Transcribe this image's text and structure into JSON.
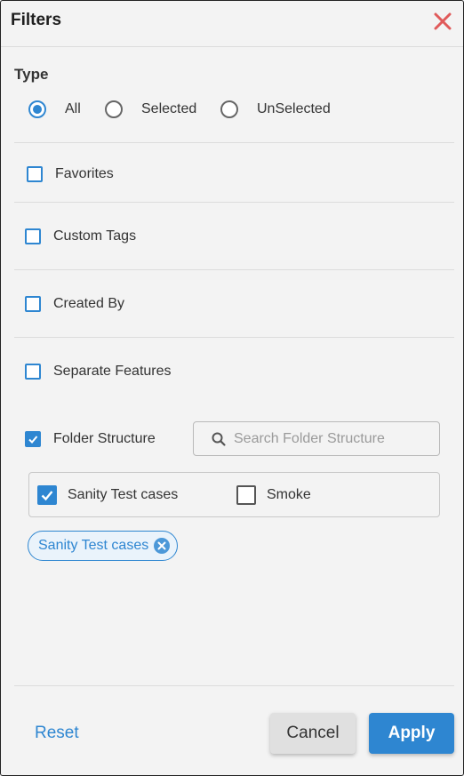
{
  "header": {
    "title": "Filters",
    "close_icon": "close-icon",
    "close_color": "#e05a5a"
  },
  "type_section": {
    "label": "Type",
    "options": [
      {
        "label": "All",
        "checked": true
      },
      {
        "label": "Selected",
        "checked": false
      },
      {
        "label": "UnSelected",
        "checked": false
      }
    ]
  },
  "filters": {
    "favorites": {
      "label": "Favorites",
      "checked": false
    },
    "custom_tags": {
      "label": "Custom Tags",
      "checked": false
    },
    "created_by": {
      "label": "Created By",
      "checked": false
    },
    "separate_features": {
      "label": "Separate Features",
      "checked": false
    },
    "folder_structure": {
      "label": "Folder Structure",
      "checked": true
    }
  },
  "folder_search": {
    "placeholder": "Search Folder Structure",
    "value": "",
    "icon": "search-icon"
  },
  "folders": [
    {
      "label": "Sanity Test cases",
      "checked": true
    },
    {
      "label": "Smoke",
      "checked": false
    }
  ],
  "selected_chips": [
    {
      "label": "Sanity Test cases"
    }
  ],
  "footer": {
    "reset_label": "Reset",
    "cancel_label": "Cancel",
    "apply_label": "Apply"
  },
  "colors": {
    "accent": "#2e86d1",
    "background": "#f3f3f3",
    "close": "#e05a5a"
  }
}
